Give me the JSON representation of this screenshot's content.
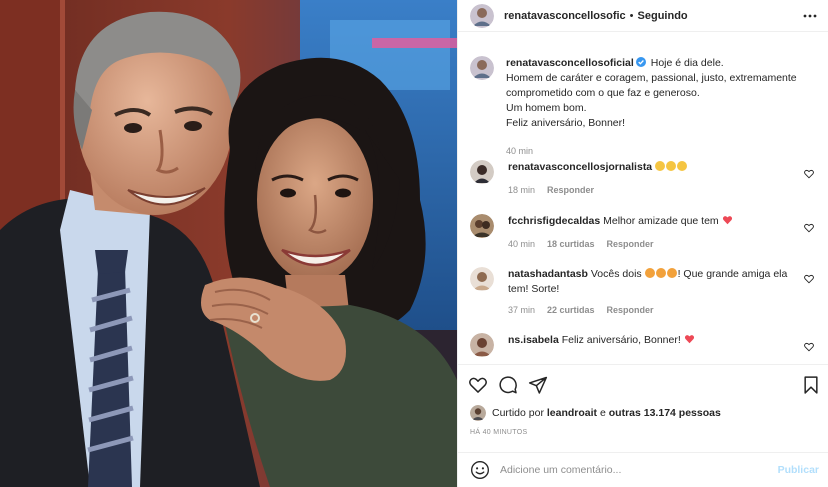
{
  "post": {
    "author": "renatavasconcellosofic",
    "separator": "•",
    "follow_status": "Seguindo"
  },
  "caption": {
    "username": "renatavasconcellosoficial",
    "lines": [
      "Hoje é dia dele.",
      "Homem de caráter e coragem, passional, justo, extremamente comprometido com o que faz e generoso.",
      "Um homem bom.",
      "Feliz aniversário, Bonner!"
    ],
    "time": "40 min"
  },
  "comments": [
    {
      "username": "renatavasconcellosjornalista",
      "text": "",
      "emoji": [
        "clap",
        "clap",
        "clap"
      ],
      "time": "18 min",
      "likes": "",
      "reply": "Responder"
    },
    {
      "username": "fcchrisfigdecaldas",
      "text": "Melhor amizade que tem",
      "emoji_after": [
        "heart"
      ],
      "time": "40 min",
      "likes": "18 curtidas",
      "reply": "Responder"
    },
    {
      "username": "natashadantasb",
      "text_before": "Vocês dois",
      "emoji_mid": [
        "heart-eyes",
        "heart-eyes",
        "heart-eyes"
      ],
      "text_after": "! Que grande amiga ela tem! Sorte!",
      "time": "37 min",
      "likes": "22 curtidas",
      "reply": "Responder"
    },
    {
      "username": "ns.isabela",
      "text": "Feliz aniversário, Bonner!",
      "emoji_after": [
        "heart"
      ],
      "time": "",
      "likes": "",
      "reply": ""
    }
  ],
  "likes": {
    "prefix": "Curtido por",
    "user": "leandroait",
    "middle": "e",
    "others": "outras 13.174 pessoas"
  },
  "time_ago": "HÁ 40 MINUTOS",
  "add_comment": {
    "placeholder": "Adicione um comentário...",
    "publish": "Publicar"
  },
  "icons": {
    "more": "more-horizontal-icon",
    "like": "heart-outline-icon",
    "comment": "comment-bubble-icon",
    "share": "paper-plane-icon",
    "save": "bookmark-icon",
    "emoji": "smiley-icon",
    "verified": "verified-badge-icon"
  },
  "colors": {
    "verified": "#3897f0",
    "heart_red": "#ed4956",
    "publish_disabled": "#b2dffc",
    "secondary_text": "#8e8e8e"
  }
}
